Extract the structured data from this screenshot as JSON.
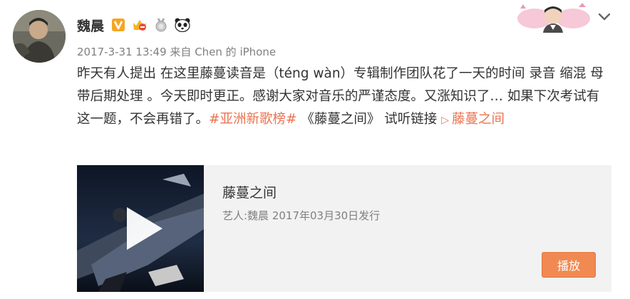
{
  "user": {
    "name": "魏晨",
    "badges": [
      "verified-v-badge",
      "vip-crown-badge",
      "silver-medal-badge",
      "panda-badge"
    ]
  },
  "meta": {
    "timestamp": "2017-3-31 13:49",
    "source_prefix": "来自",
    "source": "Chen 的 iPhone"
  },
  "post": {
    "text_main": "昨天有人提出  在这里藤蔓读音是（téng wàn）专辑制作团队花了一天的时间 录音 缩混  母带后期处理 。今天即时更正。感谢大家对音乐的严谨态度。又涨知识了… 如果下次考试有这一题，不会再错了。",
    "hashtag": "#亚洲新歌榜#",
    "text_after": " 《藤蔓之间》 试听链接  ",
    "link_label": "藤蔓之间"
  },
  "card": {
    "title": "藤蔓之间",
    "subtitle": "艺人:魏晨 2017年03月30日发行",
    "play_label": "播放"
  },
  "colors": {
    "accent": "#eb7350",
    "button": "#f08a52",
    "meta_text": "#808080"
  }
}
